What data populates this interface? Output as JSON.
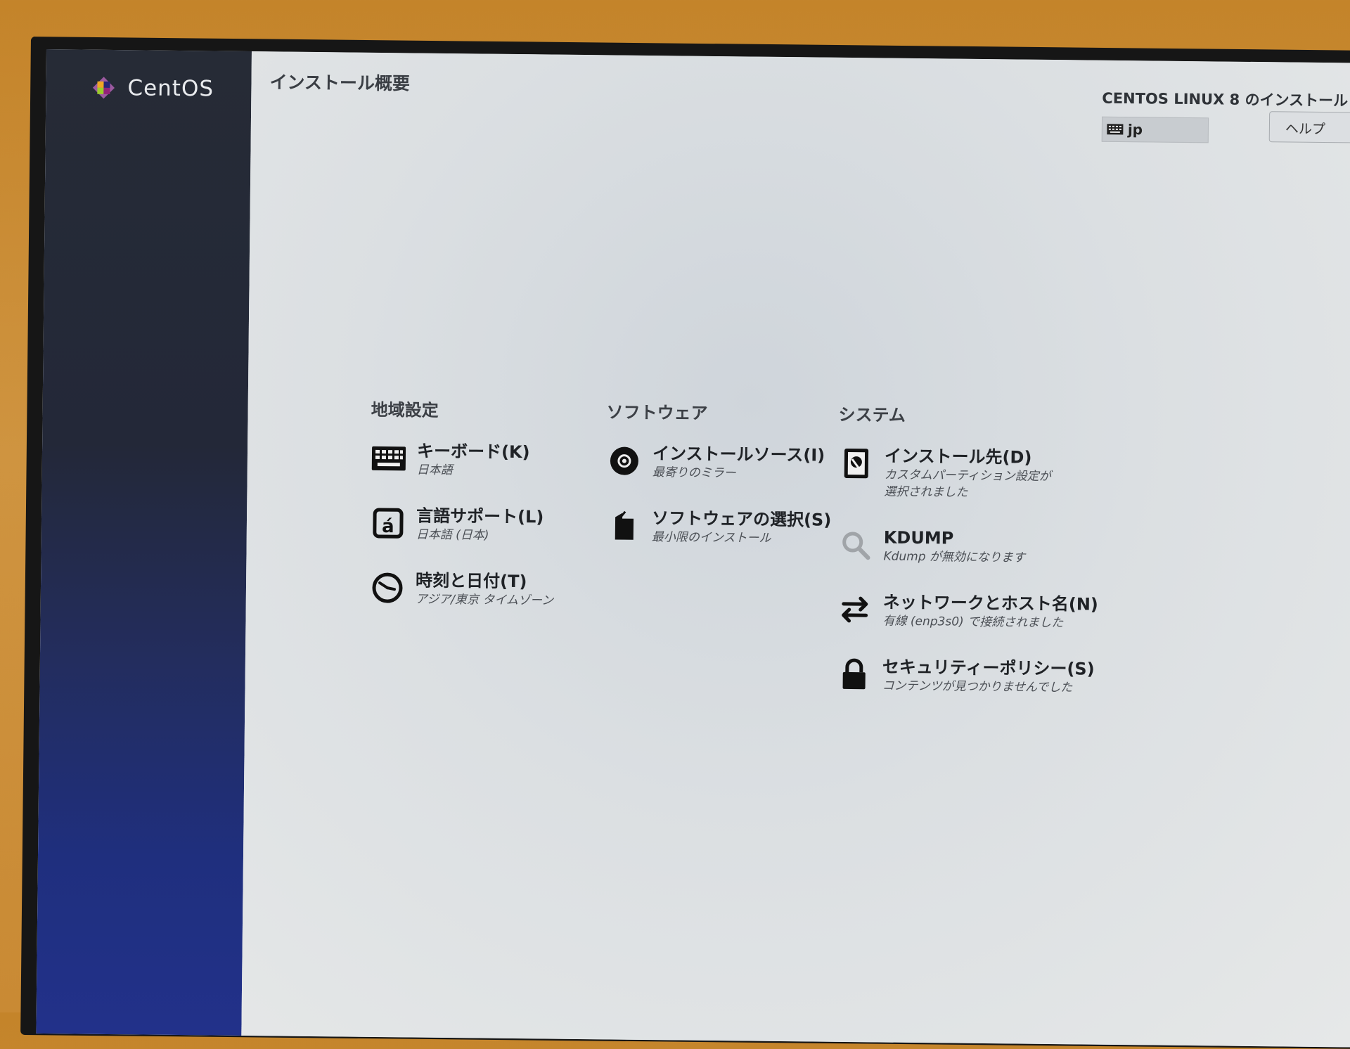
{
  "brand": {
    "name": "CentOS"
  },
  "header": {
    "page_title": "インストール概要",
    "product_title": "CENTOS LINUX 8 のインストール",
    "keyboard_layout": "jp",
    "help_label": "ヘルプ"
  },
  "categories": [
    {
      "title": "地域設定",
      "spokes": [
        {
          "icon": "keyboard-icon",
          "title": "キーボード(K)",
          "status": [
            "日本語"
          ]
        },
        {
          "icon": "language-icon",
          "title": "言語サポート(L)",
          "status": [
            "日本語 (日本)"
          ]
        },
        {
          "icon": "clock-icon",
          "title": "時刻と日付(T)",
          "status": [
            "アジア/東京 タイムゾーン"
          ]
        }
      ]
    },
    {
      "title": "ソフトウェア",
      "spokes": [
        {
          "icon": "disc-icon",
          "title": "インストールソース(I)",
          "status": [
            "最寄りのミラー"
          ]
        },
        {
          "icon": "package-icon",
          "title": "ソフトウェアの選択(S)",
          "status": [
            "最小限のインストール"
          ]
        }
      ]
    },
    {
      "title": "システム",
      "spokes": [
        {
          "icon": "hard-drive-icon",
          "title": "インストール先(D)",
          "status": [
            "カスタムパーティション設定が",
            "選択されました"
          ]
        },
        {
          "icon": "search-icon",
          "title": "KDUMP",
          "status": [
            "Kdump が無効になります"
          ]
        },
        {
          "icon": "network-arrows-icon",
          "title": "ネットワークとホスト名(N)",
          "status": [
            "有線 (enp3s0) で接続されました"
          ]
        },
        {
          "icon": "lock-icon",
          "title": "セキュリティーポリシー(S)",
          "status": [
            "コンテンツが見つかりませんでした"
          ]
        }
      ]
    }
  ]
}
